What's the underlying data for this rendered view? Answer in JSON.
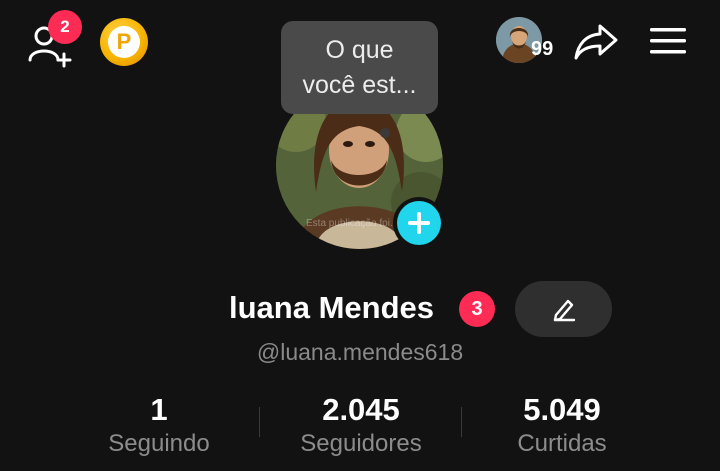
{
  "top_bar": {
    "add_friend_badge": "2",
    "coin_letter": "P",
    "recent_visitors_count": "99"
  },
  "bubble": {
    "line1": "O que",
    "line2": "você est..."
  },
  "profile": {
    "name": "luana Mendes",
    "name_badge": "3",
    "handle": "@luana.mendes618",
    "avatar_watermark": "Esta publicação foi..."
  },
  "stats": [
    {
      "value": "1",
      "label": "Seguindo"
    },
    {
      "value": "2.045",
      "label": "Seguidores"
    },
    {
      "value": "5.049",
      "label": "Curtidas"
    }
  ],
  "colors": {
    "background": "#121212",
    "badge": "#fe2c55",
    "add_button": "#20d5ec",
    "coin": "#f7b400"
  },
  "icons": [
    "add-friend-icon",
    "coin-icon",
    "share-icon",
    "menu-icon",
    "plus-icon",
    "edit-pencil-icon"
  ]
}
